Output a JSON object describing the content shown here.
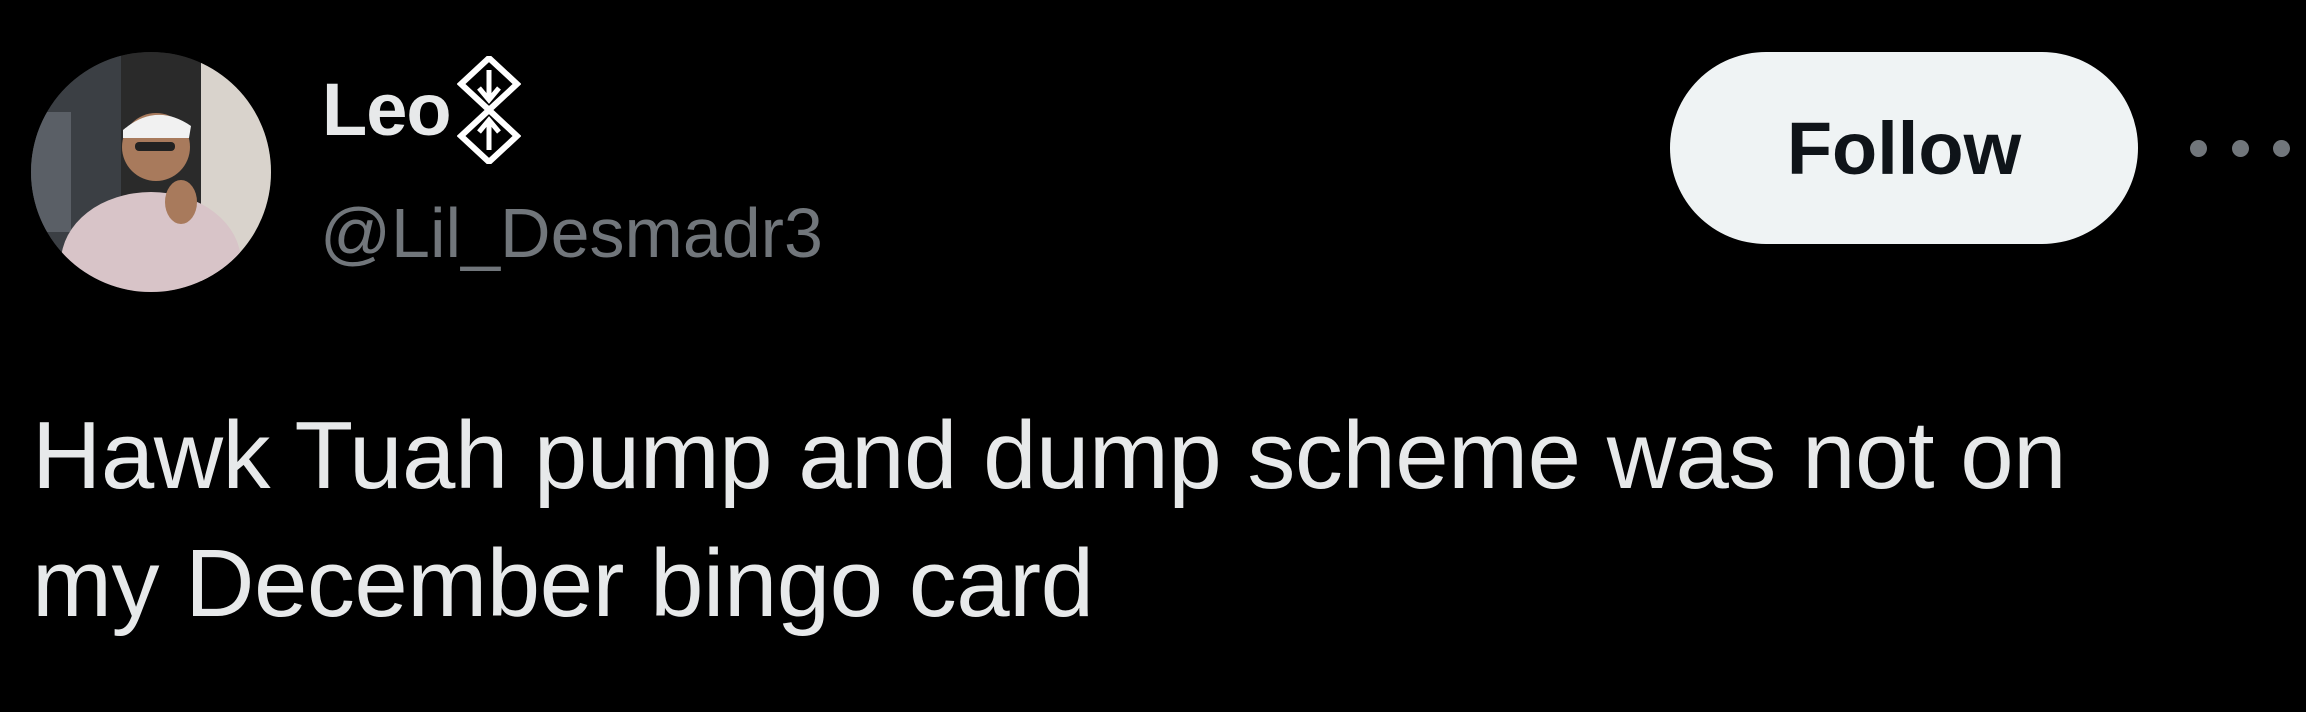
{
  "author": {
    "display_name": "Leo",
    "name_emoji": "diamond-arrow-emoji",
    "handle": "@Lil_Desmadr3",
    "avatar": "profile-photo"
  },
  "actions": {
    "follow_label": "Follow",
    "more_icon": "more-icon"
  },
  "tweet": {
    "text_line1": "Hawk Tuah pump and dump scheme was not on",
    "text_line2": "my December bingo card"
  },
  "colors": {
    "background": "#000000",
    "primary_text": "#e7e9ea",
    "secondary_text": "#71767b",
    "follow_bg": "#eff3f4",
    "follow_text": "#0f1419"
  }
}
